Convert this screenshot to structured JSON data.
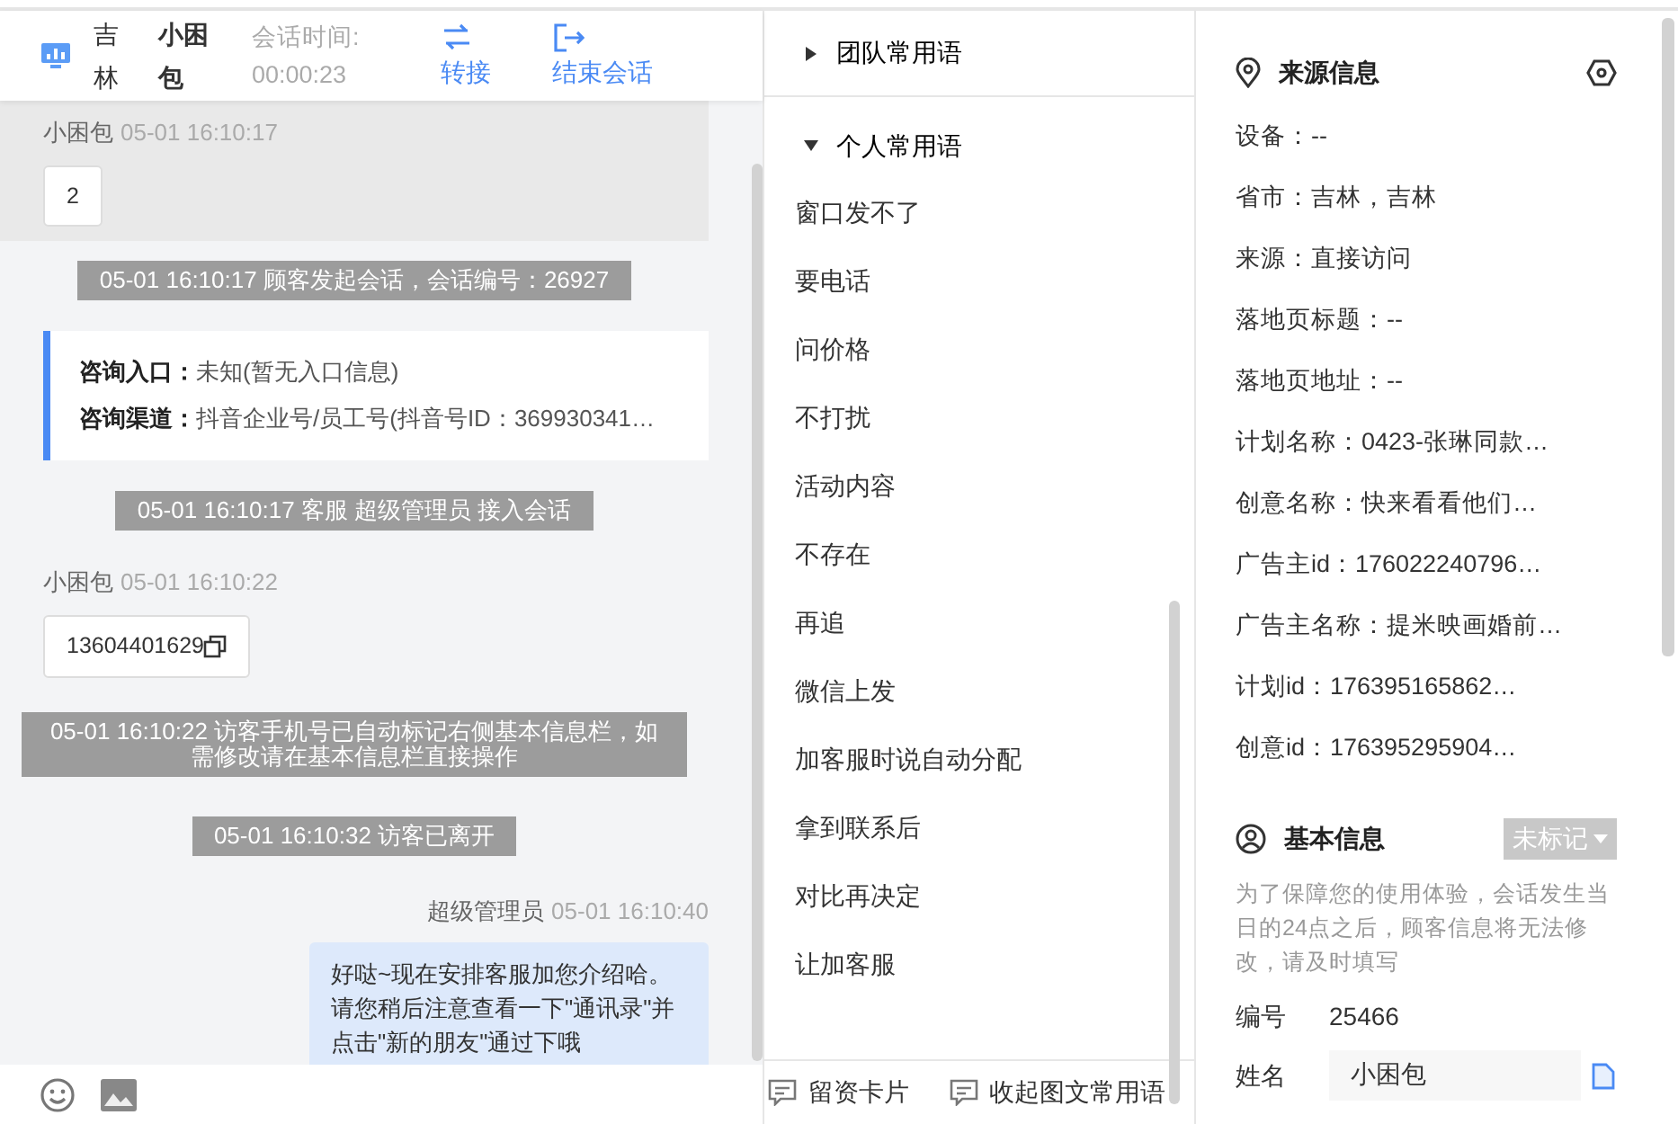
{
  "header": {
    "region": "吉林",
    "visitor": "小困包",
    "timer_label": "会话时间:",
    "timer": "00:00:23",
    "actions": [
      {
        "kind": "transfer",
        "label": "转接"
      },
      {
        "kind": "end",
        "label": "结束会话"
      }
    ]
  },
  "messages": [
    {
      "kind": "visitor",
      "sender": "小困包",
      "time": "05-01 16:10:17",
      "text": "2",
      "highlighted": true,
      "copyable": false
    },
    {
      "kind": "system",
      "text": "05-01 16:10:17 顾客发起会话，会话编号：26927"
    },
    {
      "kind": "entry_info",
      "rows": [
        {
          "label": "咨询入口：",
          "value": "未知(暂无入口信息)"
        },
        {
          "label": "咨询渠道：",
          "value": "抖音企业号/员工号(抖音号ID：369930341…"
        }
      ]
    },
    {
      "kind": "system",
      "text": "05-01 16:10:17 客服 超级管理员 接入会话"
    },
    {
      "kind": "visitor",
      "sender": "小困包",
      "time": "05-01 16:10:22",
      "text": "13604401629",
      "highlighted": false,
      "copyable": true
    },
    {
      "kind": "system",
      "text": "05-01 16:10:22 访客手机号已自动标记右侧基本信息栏，如需修改请在基本信息栏直接操作"
    },
    {
      "kind": "system",
      "text": "05-01 16:10:32 访客已离开"
    },
    {
      "kind": "agent",
      "sender": "超级管理员",
      "time": "05-01 16:10:40",
      "text": "好哒~现在安排客服加您介绍哈。请您稍后注意查看一下\"通讯录\"并点击\"新的朋友\"通过下哦"
    }
  ],
  "phrase_groups": [
    {
      "label": "团队常用语",
      "expanded": false
    },
    {
      "label": "个人常用语",
      "expanded": true,
      "children": [
        "窗口发不了",
        "要电话",
        "问价格",
        "不打扰",
        "活动内容",
        "不存在",
        "再追",
        "微信上发",
        "加客服时说自动分配",
        "拿到联系后",
        "对比再决定",
        "让加客服"
      ]
    }
  ],
  "phrase_footer": [
    "留资卡片",
    "收起图文常用语"
  ],
  "source_info": {
    "title": "来源信息",
    "rows": [
      "设备：--",
      "省市：吉林，吉林",
      "来源：直接访问",
      "落地页标题：--",
      "落地页地址：--",
      "计划名称：0423-张琳同款…",
      "创意名称：快来看看他们…",
      "广告主id：176022240796…",
      "广告主名称：提米映画婚前…",
      "计划id：176395165862…",
      "创意id：176395295904…"
    ]
  },
  "basic_info": {
    "title": "基本信息",
    "tag": "未标记",
    "notice": "为了保障您的使用体验，会话发生当日的24点之后，顾客信息将无法修改，请及时填写",
    "fields": [
      {
        "kind": "text",
        "label": "编号",
        "value": "25466"
      },
      {
        "kind": "input",
        "label": "姓名",
        "value": "小困包"
      }
    ]
  }
}
